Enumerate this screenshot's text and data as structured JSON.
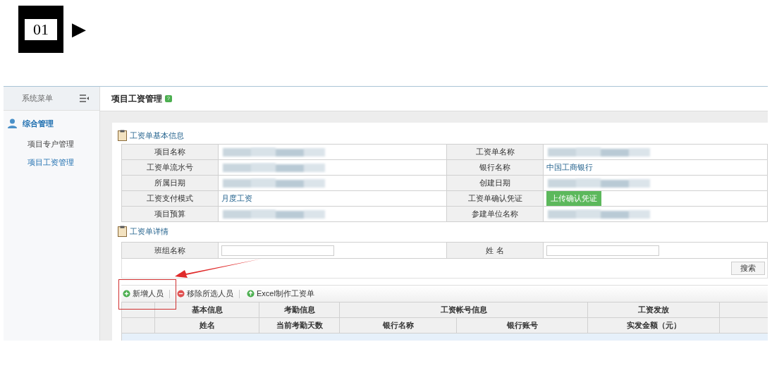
{
  "step_badge": {
    "number": "01",
    "arrow": "▶"
  },
  "sidebar": {
    "title": "系统菜单",
    "group": {
      "label": "综合管理"
    },
    "items": [
      {
        "label": "项目专户管理",
        "selected": false
      },
      {
        "label": "项目工资管理",
        "selected": true
      }
    ]
  },
  "page_title": "项目工资管理",
  "help_badge": "?",
  "basic_info": {
    "title": "工资单基本信息",
    "rows": [
      [
        {
          "label": "项目名称",
          "value": {
            "kind": "blurred"
          }
        },
        {
          "label": "工资单名称",
          "value": {
            "kind": "blurred"
          }
        }
      ],
      [
        {
          "label": "工资单流水号",
          "value": {
            "kind": "blurred"
          }
        },
        {
          "label": "银行名称",
          "value": {
            "kind": "text",
            "text": "中国工商银行"
          }
        }
      ],
      [
        {
          "label": "所属日期",
          "value": {
            "kind": "blurred"
          }
        },
        {
          "label": "创建日期",
          "value": {
            "kind": "blurred"
          }
        }
      ],
      [
        {
          "label": "工资支付模式",
          "value": {
            "kind": "text",
            "text": "月度工资"
          }
        },
        {
          "label": "工资单确认凭证",
          "value": {
            "kind": "button",
            "text": "上传确认凭证"
          }
        }
      ],
      [
        {
          "label": "项目预算",
          "value": {
            "kind": "blurred"
          }
        },
        {
          "label": "参建单位名称",
          "value": {
            "kind": "blurred"
          }
        }
      ]
    ]
  },
  "details": {
    "title": "工资单详情",
    "filters": [
      {
        "label": "班组名称"
      },
      {
        "label": "姓 名"
      }
    ],
    "search_button": "搜索",
    "toolbar": [
      {
        "label": "新增人员",
        "kind": "add",
        "highlighted": true
      },
      {
        "label": "移除所选人员",
        "kind": "remove",
        "highlighted": false
      },
      {
        "label": "Excel制作工资单",
        "kind": "upload",
        "highlighted": false
      }
    ],
    "table": {
      "groups": [
        {
          "label": "基本信息",
          "columns": [
            "姓名"
          ]
        },
        {
          "label": "考勤信息",
          "columns": [
            "当前考勤天数"
          ]
        },
        {
          "label": "工资帐号信息",
          "columns": [
            "银行名称",
            "银行账号"
          ]
        },
        {
          "label": "工资发放",
          "columns": [
            "实发金额（元）"
          ]
        }
      ]
    }
  }
}
